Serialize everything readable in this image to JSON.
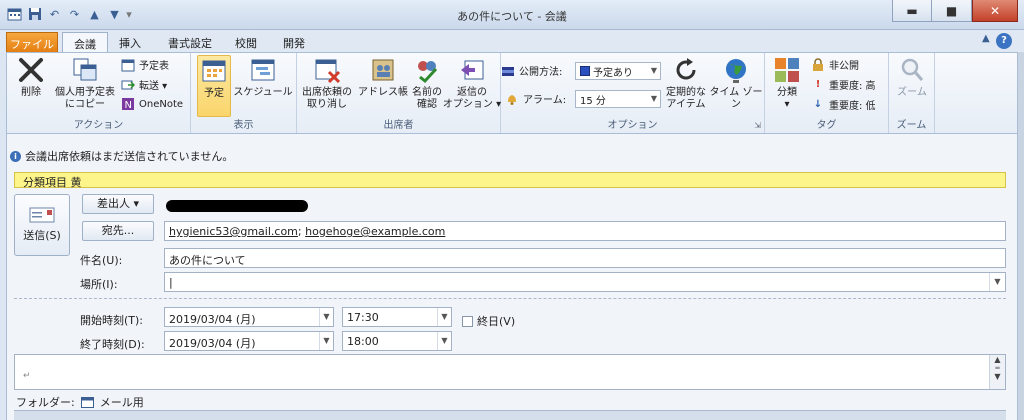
{
  "window": {
    "title": "あの件について - 会議",
    "minimize": "▬",
    "maximize": "■",
    "close": "✕"
  },
  "qat": {
    "undo": "↶",
    "redo": "↷",
    "up": "▲",
    "down": "▼",
    "customize": "▾"
  },
  "tabs": [
    "ファイル",
    "会議",
    "挿入",
    "書式設定",
    "校閲",
    "開発"
  ],
  "ribbon_controls": {
    "collapse": "▲",
    "help": "?"
  },
  "ribbon": {
    "actions": {
      "label": "アクション",
      "delete": "削除",
      "copy_to_calendar": "個人用予定表\nにコピー",
      "calendar": "予定表",
      "forward": "転送 ▾",
      "onenote": "OneNote"
    },
    "show": {
      "label": "表示",
      "appointment": "予定",
      "scheduling": "スケジュール"
    },
    "attendees": {
      "label": "出席者",
      "cancel_invitation": "出席依頼の\n取り消し",
      "address_book": "アドレス帳",
      "check_names": "名前の\n確認",
      "response_options": "返信の\nオプション ▾"
    },
    "options": {
      "label": "オプション",
      "show_as_label": "公開方法:",
      "show_as_value": "予定あり",
      "reminder_label": "アラーム:",
      "reminder_value": "15 分",
      "recurrence": "定期的な\nアイテム",
      "time_zones": "タイム ゾーン",
      "launcher": "⇲"
    },
    "tags": {
      "label": "タグ",
      "categorize": "分類\n▾",
      "private": "非公開",
      "high_importance": "重要度: 高",
      "low_importance": "重要度: 低"
    },
    "zoom": {
      "label": "ズーム",
      "zoom": "ズーム"
    }
  },
  "info_bar": "会議出席依頼はまだ送信されていません。",
  "category_bar": "分類項目 黄",
  "form": {
    "send": "送信(S)",
    "from_button": "差出人 ▾",
    "to_button": "宛先...",
    "to_value_1": "hygienic53@gmail.com",
    "to_separator": ";",
    "to_value_2": "hogehoge@example.com",
    "subject_label": "件名(U):",
    "subject_value": "あの件について",
    "location_label": "場所(I):",
    "location_value": "|",
    "start_label": "開始時刻(T):",
    "start_date": "2019/03/04 (月)",
    "start_time": "17:30",
    "all_day": "終日(V)",
    "end_label": "終了時刻(D):",
    "end_date": "2019/03/04 (月)",
    "end_time": "18:00",
    "body_mark": "↵",
    "folder_label": "フォルダー:",
    "folder_value": "メール用"
  }
}
